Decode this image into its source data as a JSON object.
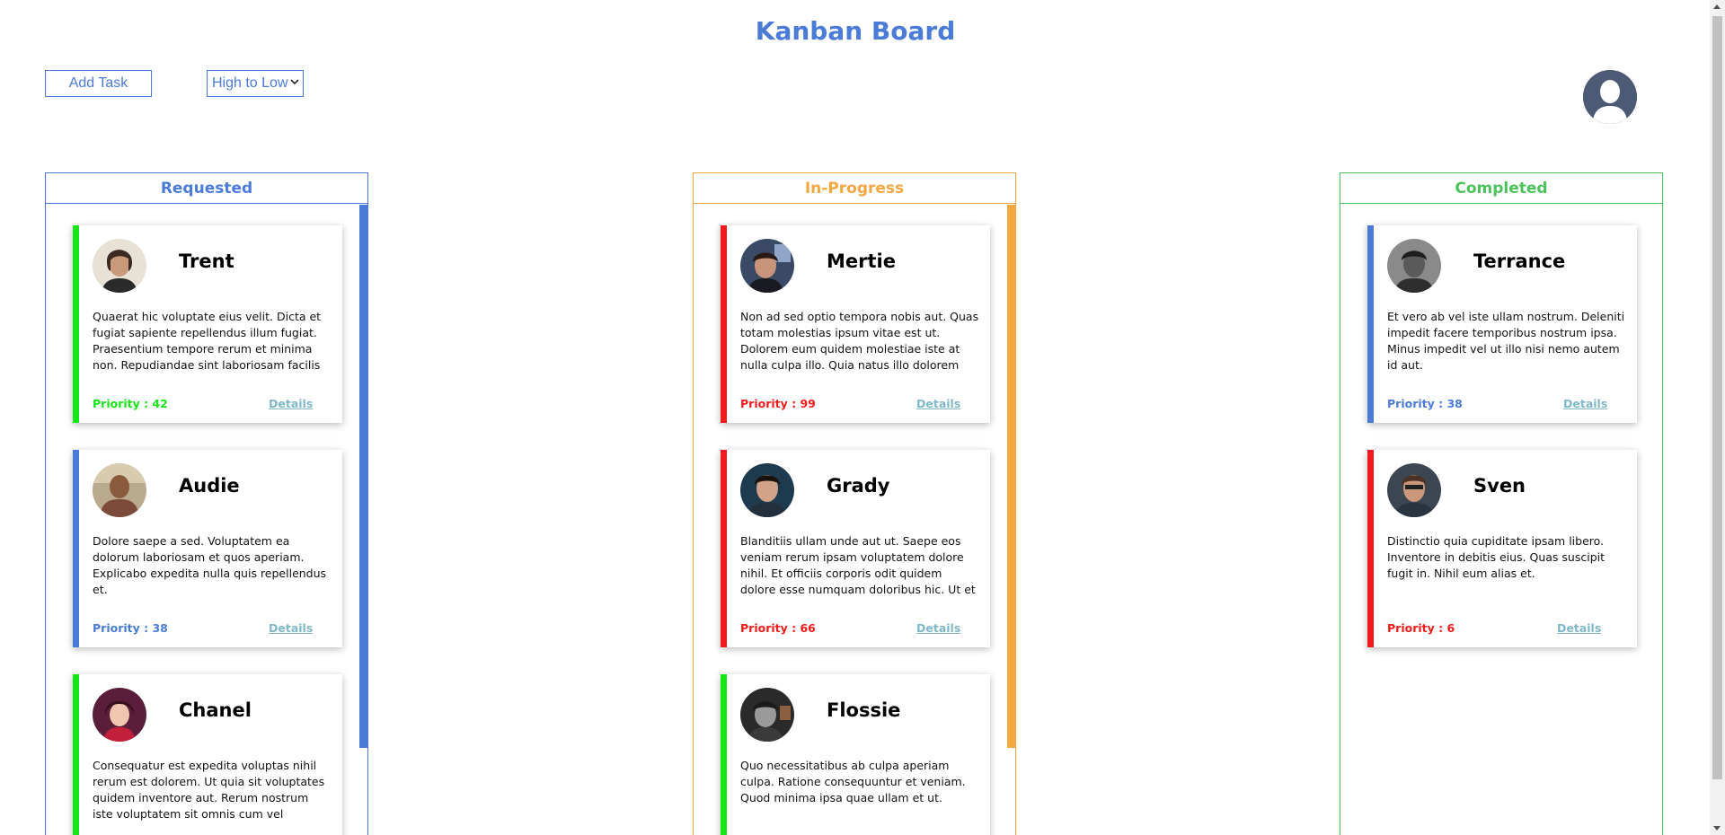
{
  "header": {
    "title": "Kanban Board"
  },
  "toolbar": {
    "add_task_label": "Add Task",
    "sort_selected": "High to Low"
  },
  "profile": {
    "icon": "user-avatar-icon"
  },
  "colors": {
    "accent": "#4a7bd7",
    "requested": "#4a7bd7",
    "in_progress": "#f5a742",
    "completed": "#4cc25a",
    "priority_high": "#f21b1b",
    "priority_low": "#16e516",
    "priority_mid": "#4a7bd7",
    "details_link": "#7fb8c8"
  },
  "columns": [
    {
      "title": "Requested",
      "cards": [
        {
          "name": "Trent",
          "description": "Quaerat hic voluptate eius velit. Dicta et fugiat sapiente repellendus illum fugiat. Praesentium tempore rerum et minima non. Repudiandae sint laboriosam facilis corporis ipsam magni fugit eius.",
          "priority": "Priority : 42",
          "details": "Details"
        },
        {
          "name": "Audie",
          "description": "Dolore saepe a sed. Voluptatem ea dolorum laboriosam et quos aperiam. Explicabo expedita nulla quis repellendus et.",
          "priority": "Priority : 38",
          "details": "Details"
        },
        {
          "name": "Chanel",
          "description": "Consequatur est expedita voluptas nihil rerum est dolorem. Ut quia sit voluptates quidem inventore aut. Rerum nostrum iste voluptatem sit omnis cum vel distinctio",
          "priority": "",
          "details": ""
        }
      ]
    },
    {
      "title": "In-Progress",
      "cards": [
        {
          "name": "Mertie",
          "description": "Non ad sed optio tempora nobis aut. Quas totam molestias ipsum vitae est ut. Dolorem eum quidem molestiae iste at nulla culpa illo. Quia natus illo dolorem rerum nihil quia sunt.",
          "priority": "Priority : 99",
          "details": "Details"
        },
        {
          "name": "Grady",
          "description": "Blanditiis ullam unde aut ut. Saepe eos veniam rerum ipsam voluptatem dolore nihil. Et officiis corporis odit quidem dolore esse numquam doloribus hic. Ut et accusamus dolor quasi.",
          "priority": "Priority : 66",
          "details": "Details"
        },
        {
          "name": "Flossie",
          "description": "Quo necessitatibus ab culpa aperiam culpa. Ratione consequuntur et veniam. Quod minima ipsa quae ullam et ut.",
          "priority": "",
          "details": ""
        }
      ]
    },
    {
      "title": "Completed",
      "cards": [
        {
          "name": "Terrance",
          "description": "Et vero ab vel iste ullam nostrum. Deleniti impedit facere temporibus nostrum ipsa. Minus impedit vel ut illo nisi nemo autem id aut.",
          "priority": "Priority : 38",
          "details": "Details"
        },
        {
          "name": "Sven",
          "description": "Distinctio quia cupiditate ipsam libero. Inventore in debitis eius. Quas suscipit fugit in. Nihil eum alias et.",
          "priority": "Priority : 6",
          "details": "Details"
        }
      ]
    }
  ]
}
